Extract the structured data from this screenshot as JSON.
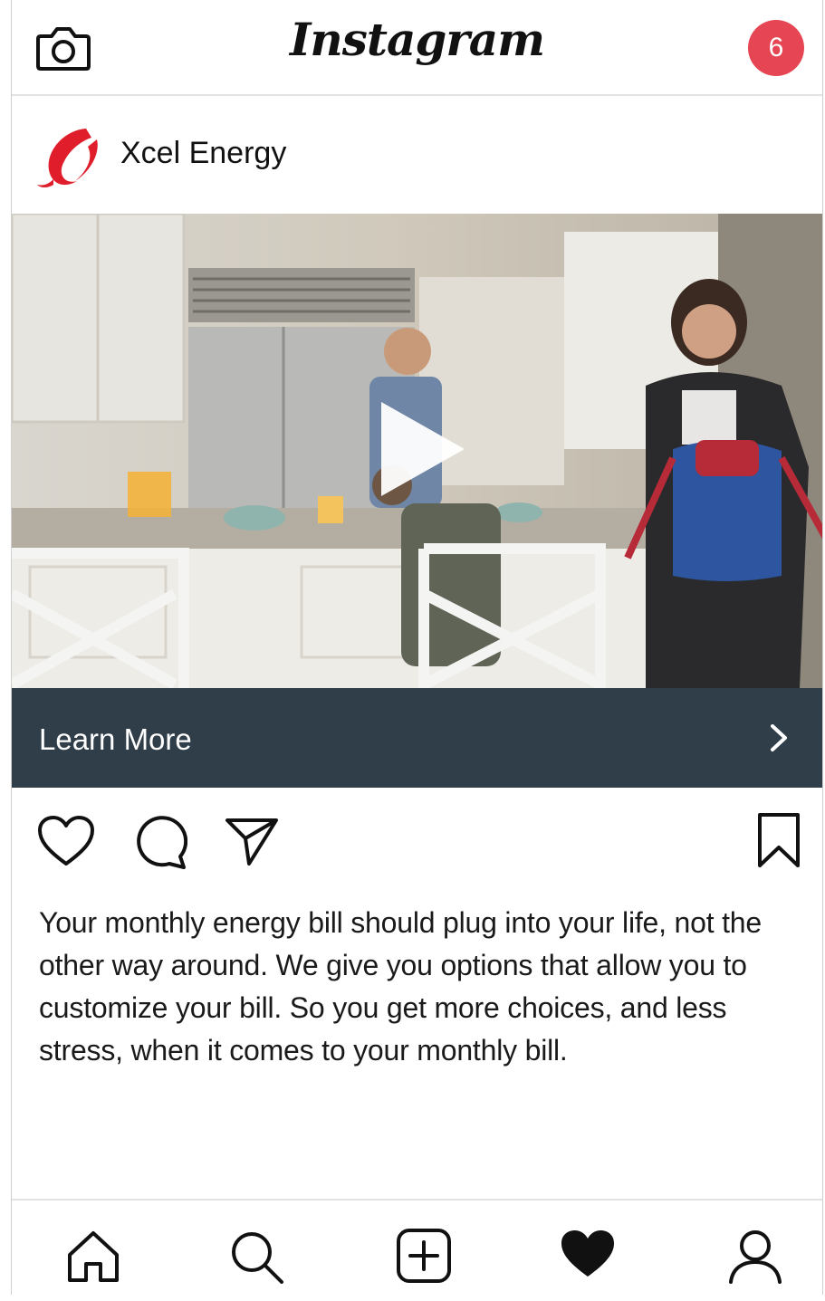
{
  "app": {
    "title": "Instagram",
    "notification_count": "6",
    "colors": {
      "badge": "#e64553",
      "cta_bg": "#2f3e49",
      "brand_red": "#e01e2b"
    }
  },
  "post": {
    "account_name": "Xcel Energy",
    "cta_label": "Learn More",
    "caption": "Your monthly energy bill should plug into your life, not the other way around. We give you options that allow you to customize your bill. So you get more choices, and less stress, when it comes to your monthly bill."
  },
  "icons": {
    "top": [
      "camera-icon"
    ],
    "actions": [
      "heart-outline-icon",
      "comment-icon",
      "send-icon",
      "bookmark-icon"
    ],
    "bottom_nav": [
      "home-icon",
      "search-icon",
      "add-post-icon",
      "activity-heart-icon",
      "profile-icon"
    ]
  }
}
